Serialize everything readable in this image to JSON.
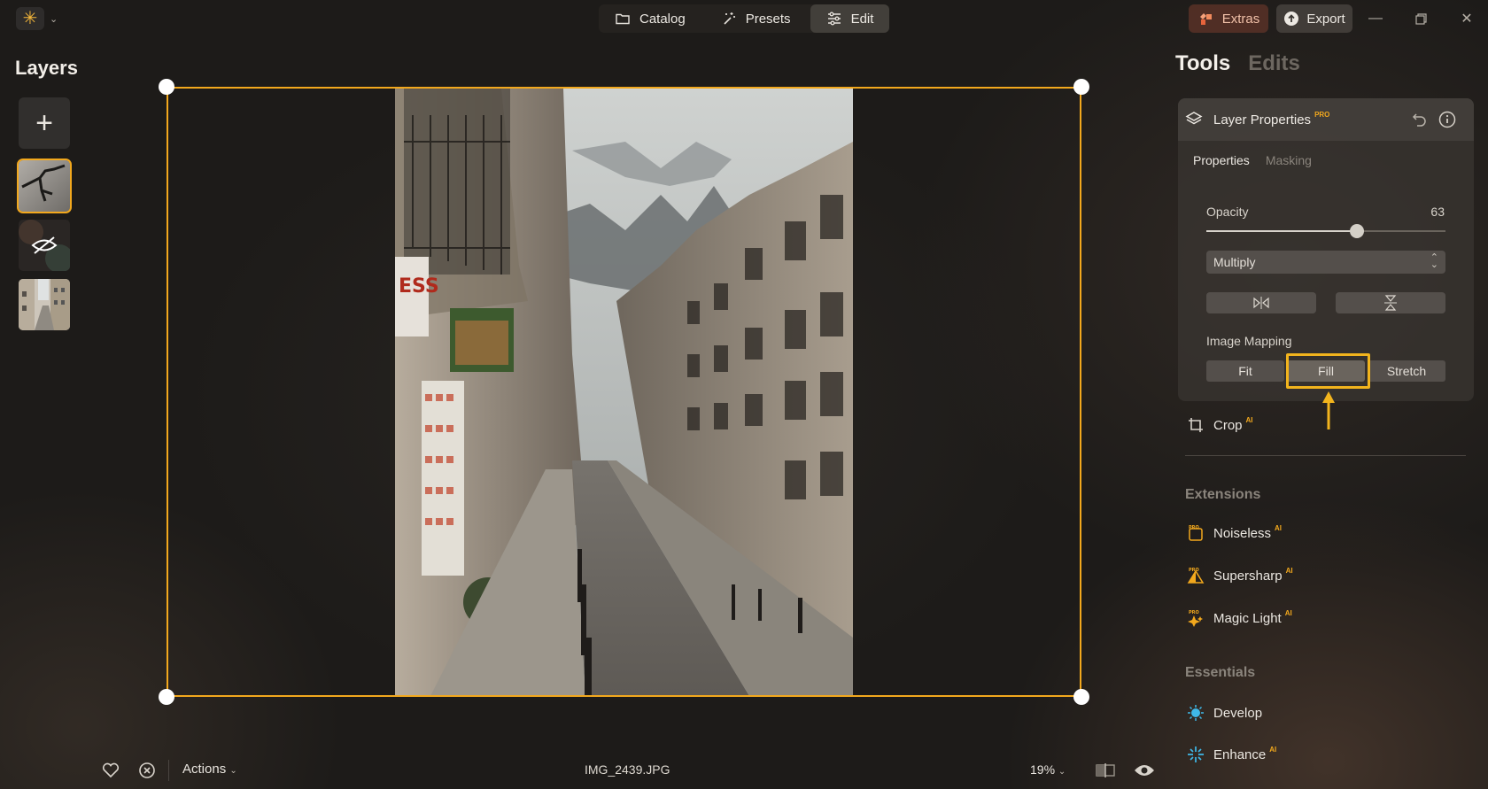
{
  "app": {
    "logo_icon": "sun-logo-icon",
    "accent_color": "#f2a81d"
  },
  "nav": {
    "catalog_label": "Catalog",
    "presets_label": "Presets",
    "edit_label": "Edit",
    "active": "Edit"
  },
  "header_right": {
    "extras_label": "Extras",
    "export_label": "Export",
    "window_controls": [
      "minimize-icon",
      "restore-icon",
      "close-icon"
    ]
  },
  "layers": {
    "title": "Layers",
    "add_symbol": "+",
    "items": [
      {
        "name": "crack-texture-layer",
        "selected": true
      },
      {
        "name": "hidden-layer",
        "selected": false
      },
      {
        "name": "street-photo-layer",
        "selected": false
      }
    ]
  },
  "canvas": {
    "filename": "IMG_2439.JPG"
  },
  "bottom_bar": {
    "actions_label": "Actions",
    "zoom_label": "19%",
    "favorite_icon": "heart-icon",
    "reject_icon": "reject-icon",
    "compare_icon": "compare-icon",
    "preview_icon": "eye-icon"
  },
  "panel": {
    "tab_tools": "Tools",
    "tab_edits": "Edits",
    "layer_properties": {
      "title": "Layer Properties",
      "pro_badge": "PRO",
      "tab_properties": "Properties",
      "tab_masking": "Masking",
      "opacity_label": "Opacity",
      "opacity_value": "63",
      "opacity_fraction": 0.63,
      "blend_mode": "Multiply",
      "image_mapping_label": "Image Mapping",
      "mapping_options": [
        "Fit",
        "Fill",
        "Stretch"
      ],
      "mapping_selected": "Fill"
    },
    "crop": {
      "label": "Crop",
      "ai_badge": "AI"
    },
    "extensions_title": "Extensions",
    "extensions": [
      {
        "label": "Noiseless",
        "badge": "AI",
        "icon": "noiseless-icon"
      },
      {
        "label": "Supersharp",
        "badge": "AI",
        "icon": "supersharp-icon"
      },
      {
        "label": "Magic Light",
        "badge": "AI",
        "icon": "magic-light-icon"
      }
    ],
    "essentials_title": "Essentials",
    "essentials": [
      {
        "label": "Develop",
        "badge": "",
        "icon": "develop-icon"
      },
      {
        "label": "Enhance",
        "badge": "AI",
        "icon": "enhance-icon"
      }
    ]
  }
}
